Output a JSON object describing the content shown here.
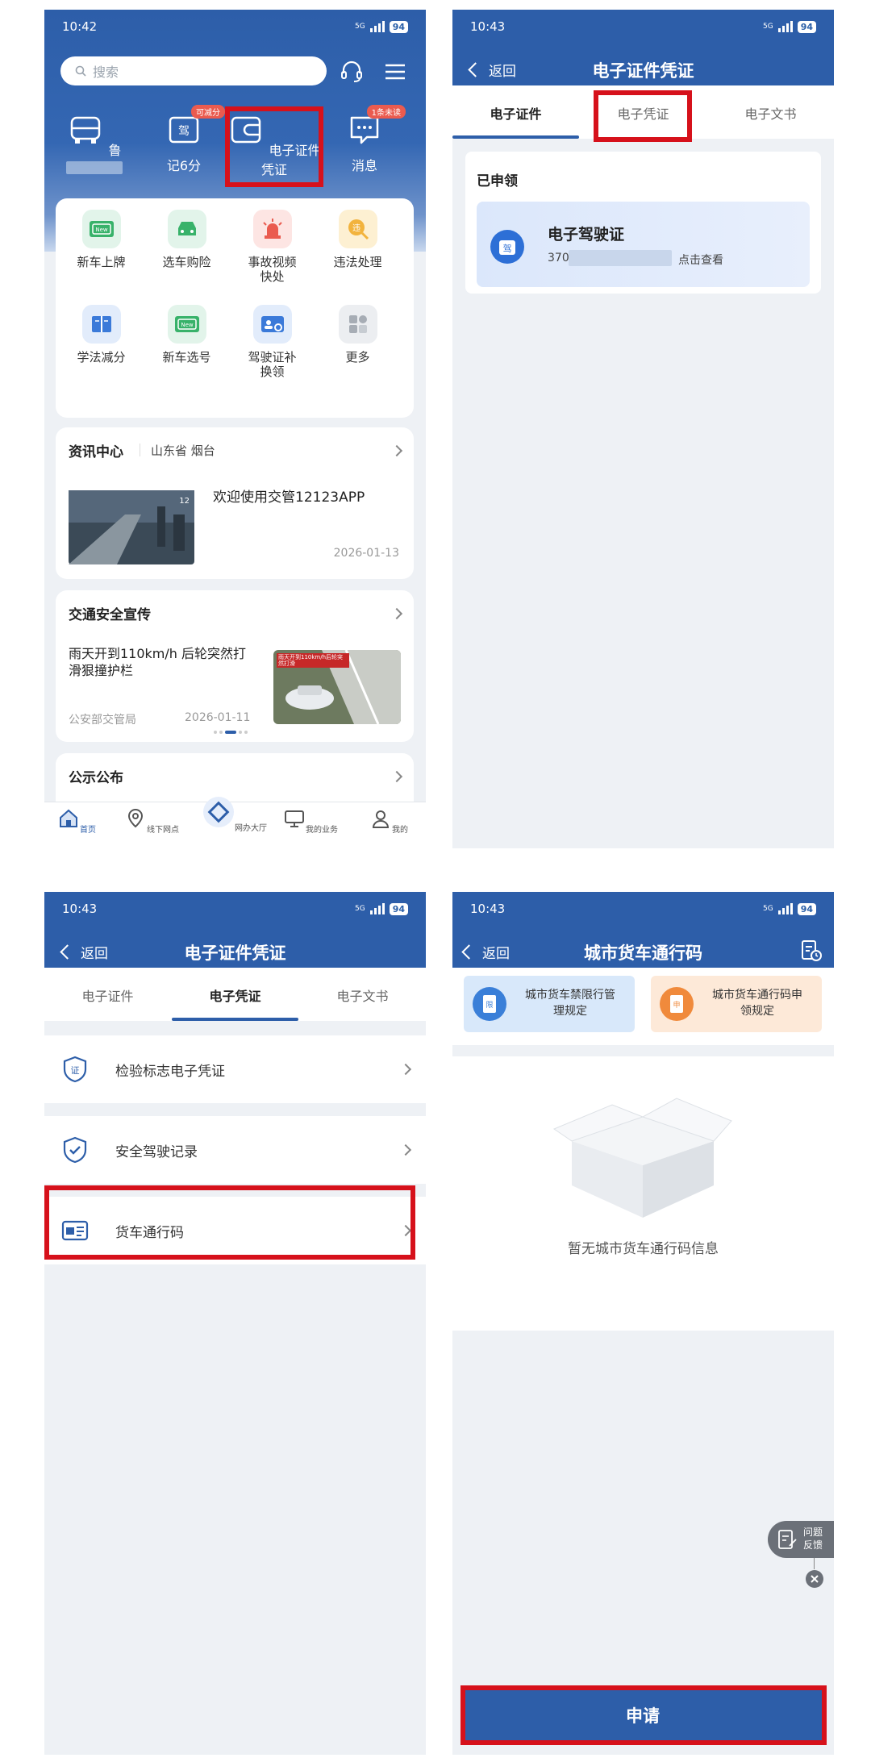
{
  "status": {
    "time1": "10:42",
    "time2": "10:43",
    "time3": "10:43",
    "time4": "10:43",
    "battery": "94",
    "network": "5G"
  },
  "home": {
    "search_placeholder": "搜索",
    "quick": [
      {
        "label": "鲁",
        "icon": "car-icon"
      },
      {
        "label": "记6分",
        "badge": "可减分",
        "icon": "license-card-icon"
      },
      {
        "label": "电子证件凭证",
        "icon": "wallet-icon"
      },
      {
        "label": "消息",
        "badge": "1条未读",
        "icon": "message-icon"
      }
    ],
    "services": [
      {
        "label": "新车上牌",
        "icon": "new-plate-icon"
      },
      {
        "label": "选车购险",
        "icon": "car-insurance-icon"
      },
      {
        "label": "事故视频快处",
        "icon": "alarm-light-icon"
      },
      {
        "label": "违法处理",
        "icon": "violation-icon"
      },
      {
        "label": "学法减分",
        "icon": "book-icon"
      },
      {
        "label": "新车选号",
        "icon": "plate-number-icon"
      },
      {
        "label": "驾驶证补换领",
        "icon": "id-card-icon"
      },
      {
        "label": "更多",
        "icon": "more-grid-icon"
      }
    ],
    "news": {
      "title": "资讯中心",
      "location": "山东省 烟台",
      "headline": "欢迎使用交管12123APP",
      "date": "2026-01-13"
    },
    "safety": {
      "title": "交通安全宣传",
      "headline": "雨天开到110km/h 后轮突然打滑狠撞护栏",
      "source": "公安部交管局",
      "date": "2026-01-11",
      "thumb_caption": "雨天开到110km/h后轮突然打滑"
    },
    "notice": {
      "title": "公示公布"
    },
    "nav": [
      "首页",
      "线下网点",
      "网办大厅",
      "我的业务",
      "我的"
    ]
  },
  "certs": {
    "back": "返回",
    "title": "电子证件凭证",
    "tabs": [
      "电子证件",
      "电子凭证",
      "电子文书"
    ],
    "section": "已申领",
    "license_name": "电子驾驶证",
    "license_id_prefix": "370",
    "license_action": "点击查看",
    "license_glyph": "驾"
  },
  "vouchers": {
    "items": [
      {
        "label": "检验标志电子凭证",
        "icon": "shield-cert-icon",
        "glyph": "证"
      },
      {
        "label": "安全驾驶记录",
        "icon": "shield-check-icon"
      },
      {
        "label": "货车通行码",
        "icon": "truck-pass-icon"
      }
    ]
  },
  "truck": {
    "title": "城市货车通行码",
    "info_cards": [
      {
        "label": "城市货车禁限行管理规定",
        "glyph": "限"
      },
      {
        "label": "城市货车通行码申领规定",
        "glyph": "申"
      }
    ],
    "empty_text": "暂无城市货车通行码信息",
    "feedback": "问题反馈",
    "apply": "申请"
  },
  "colors": {
    "primary": "#2d5ea9",
    "highlight_box": "#d6111b",
    "badge": "#ea5b4f"
  }
}
